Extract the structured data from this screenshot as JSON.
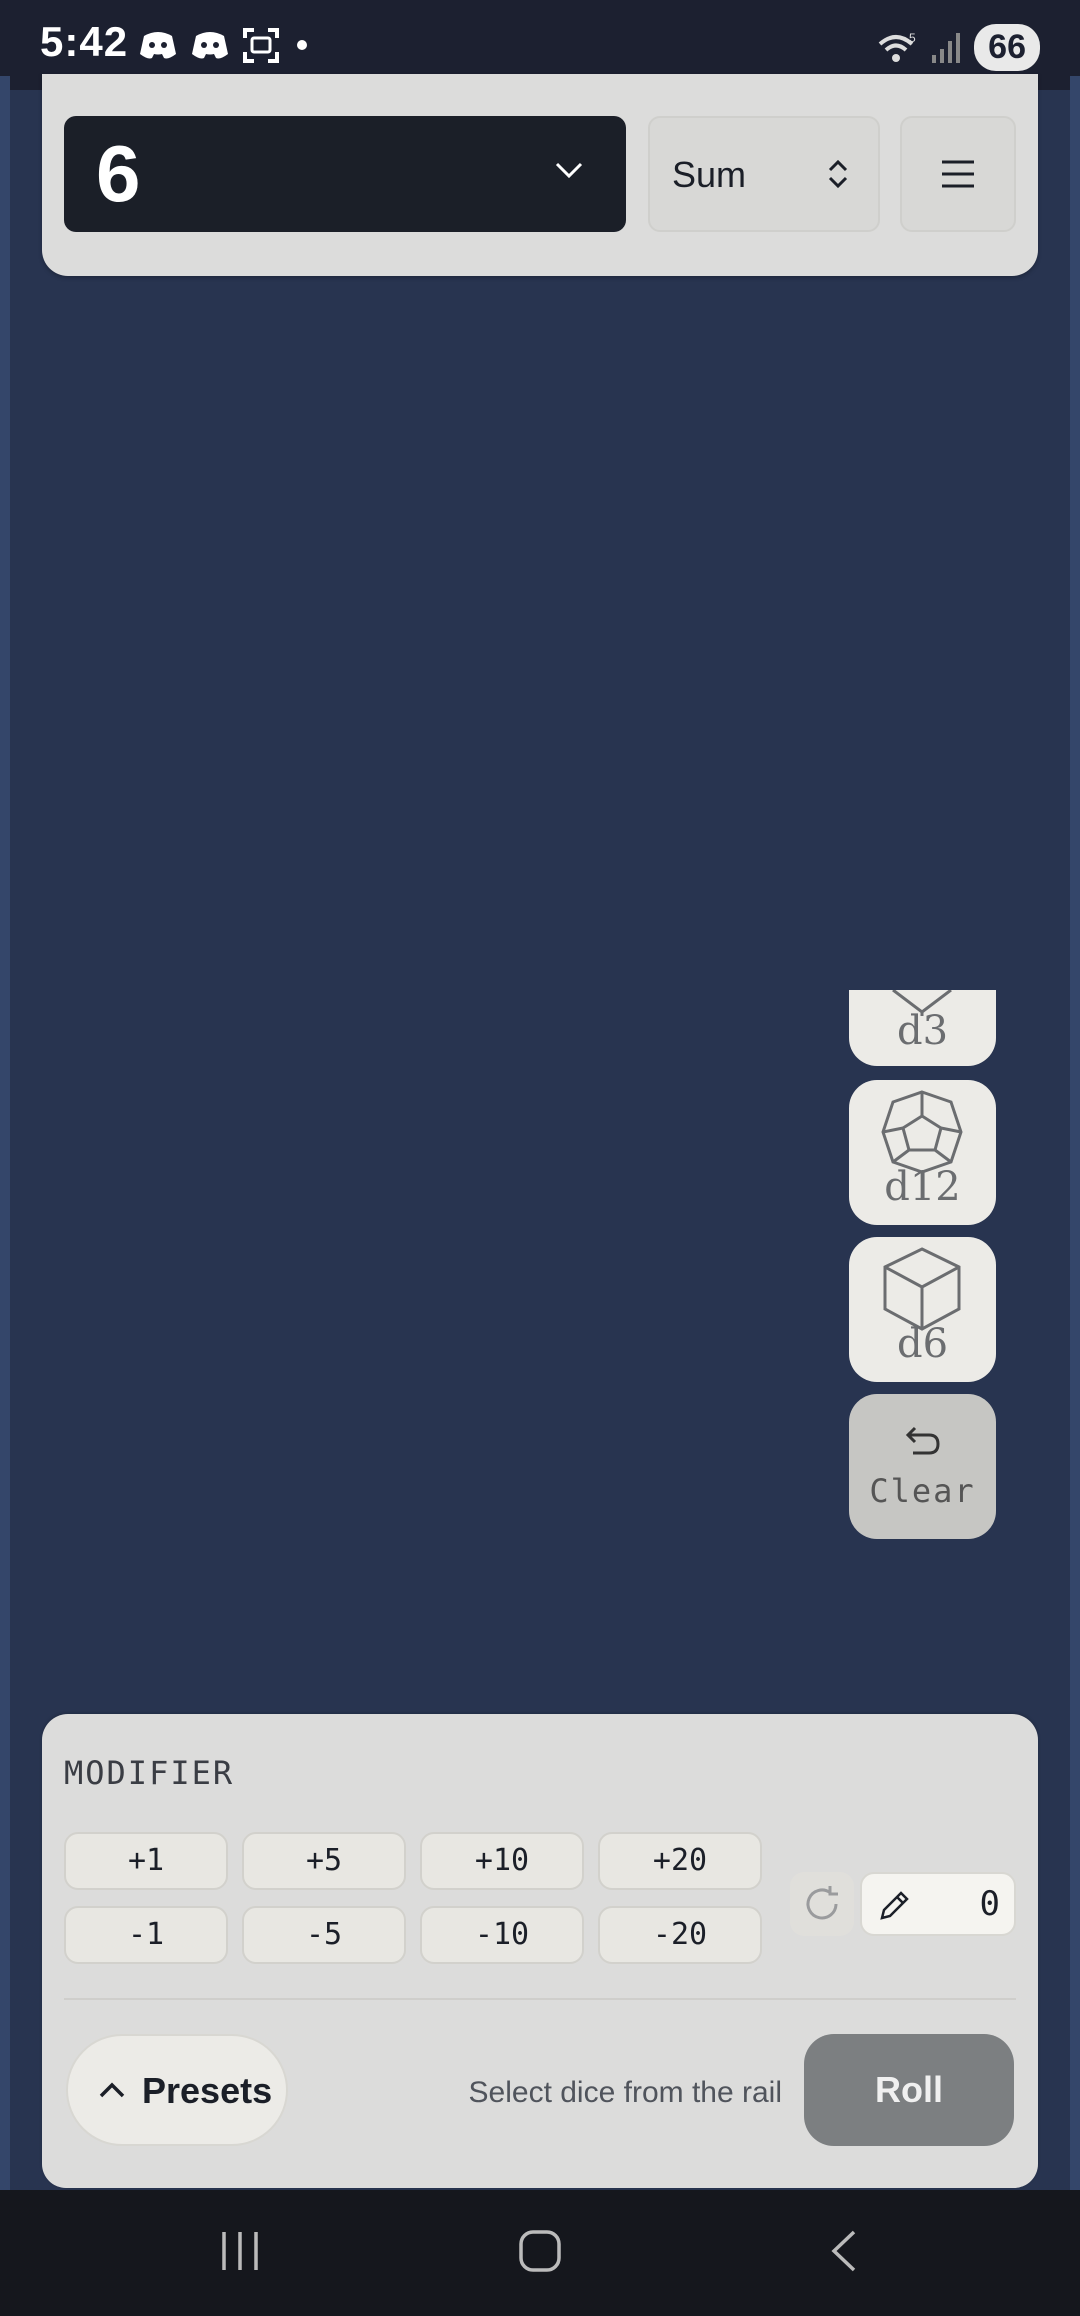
{
  "status_bar": {
    "time": "5:42",
    "notification_icons": [
      "discord-icon",
      "discord-icon",
      "screenshot-icon",
      "dot-icon"
    ],
    "battery": "66",
    "wifi_label": "5"
  },
  "top_bar": {
    "dice_count": "6",
    "mode": "Sum",
    "menu_icon": "hamburger-icon"
  },
  "dice_rail": {
    "items": [
      {
        "label": "d3",
        "icon": "d3-die-icon"
      },
      {
        "label": "d12",
        "icon": "d12-die-icon"
      },
      {
        "label": "d6",
        "icon": "d6-die-icon"
      }
    ],
    "clear_label": "Clear"
  },
  "modifier": {
    "title": "MODIFIER",
    "positive": [
      "+1",
      "+5",
      "+10",
      "+20"
    ],
    "negative": [
      "-1",
      "-5",
      "-10",
      "-20"
    ],
    "value": "0"
  },
  "footer": {
    "presets_label": "Presets",
    "hint": "Select dice from the rail",
    "roll_label": "Roll"
  },
  "colors": {
    "background": "#283450",
    "panel": "#dcdcdb",
    "dark": "#1b1f28",
    "roll_disabled": "#7c7f81"
  }
}
